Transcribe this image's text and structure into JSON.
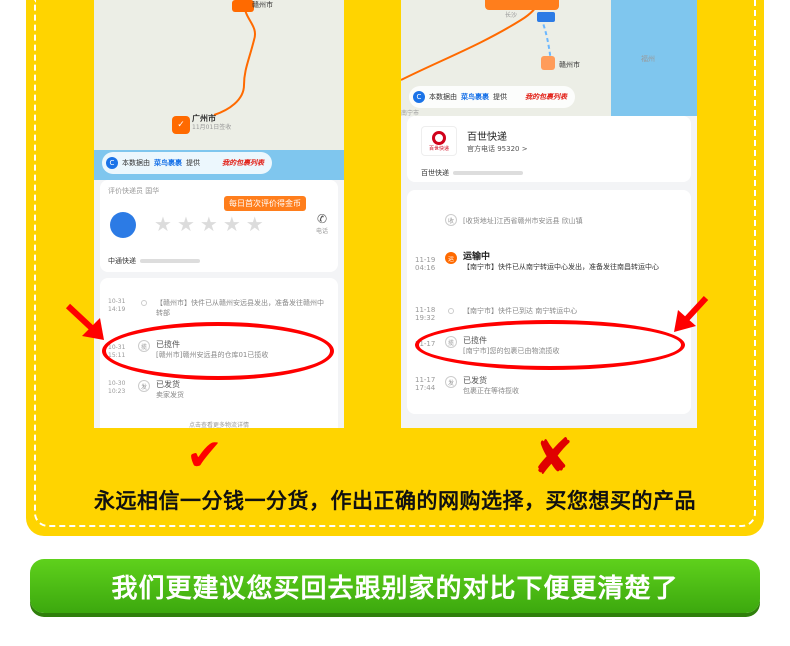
{
  "left_panel": {
    "map": {
      "top_city": "赣州市",
      "gz_city": "广州市",
      "gz_date": "11月01日签收"
    },
    "attribution": {
      "prefix": "本数据由",
      "brand": "菜鸟裹裹",
      "suffix": "提供",
      "link": "我的包裹列表"
    },
    "rating_card": {
      "header": "评价快递员 国华",
      "reward_tag": "每日首次评价得金币",
      "star_count": 5,
      "phone_label": "电话",
      "courier_name": "中通快递"
    },
    "timeline": [
      {
        "date": "10-31",
        "time": "14:19",
        "icon": "",
        "title": "",
        "text": "【赣州市】快件已从赣州安远县发出，准备发往赣州中转部"
      },
      {
        "date": "10-31",
        "time": "15:11",
        "icon": "揽",
        "title": "已揽件",
        "text": "[赣州市]赣州安远县的仓库01已揽收"
      },
      {
        "date": "10-30",
        "time": "10:23",
        "icon": "发",
        "title": "已发货",
        "text": "卖家发货"
      }
    ],
    "more_link": "点击查看更多物流详情"
  },
  "right_panel": {
    "map": {
      "truck_city": "长沙",
      "gz_city": "赣州市",
      "fuzhou": "福州",
      "nanning": "南宁市"
    },
    "attribution": {
      "prefix": "本数据由",
      "brand": "菜鸟裹裹",
      "suffix": "提供",
      "link": "我的包裹列表"
    },
    "company_card": {
      "logo_text": "百世快递",
      "name": "百世快递",
      "phone": "官方电话 95320 >",
      "tracking_label": "百世快递"
    },
    "timeline": [
      {
        "date": "",
        "time": "",
        "icon": "收",
        "title": "",
        "text": "[收货地址]江西省赣州市安远县 欣山镇"
      },
      {
        "date": "11-19",
        "time": "04:16",
        "icon": "运",
        "title": "运输中",
        "text": "【南宁市】快件已从南宁转运中心发出，准备发往南昌转运中心"
      },
      {
        "date": "11-18",
        "time": "19:32",
        "icon": "",
        "title": "",
        "text": "【南宁市】快件已到达 南宁转运中心"
      },
      {
        "date": "11-17",
        "time": "",
        "icon": "揽",
        "title": "已揽件",
        "text": "[南宁市]您的包裹已由物流揽收"
      },
      {
        "date": "11-17",
        "time": "17:44",
        "icon": "发",
        "title": "已发货",
        "text": "包裹正在等待揽收"
      }
    ]
  },
  "marks": {
    "check": "✔",
    "cross": "✘"
  },
  "slogan": "永远相信一分钱一分货，作出正确的网购选择，买您想买的产品",
  "banner": "我们更建议您买回去跟别家的对比下便更清楚了",
  "colors": {
    "yellow": "#ffd400",
    "green": "#3ca80e",
    "red_mark": "#ff0000",
    "orange": "#ff6a00"
  }
}
